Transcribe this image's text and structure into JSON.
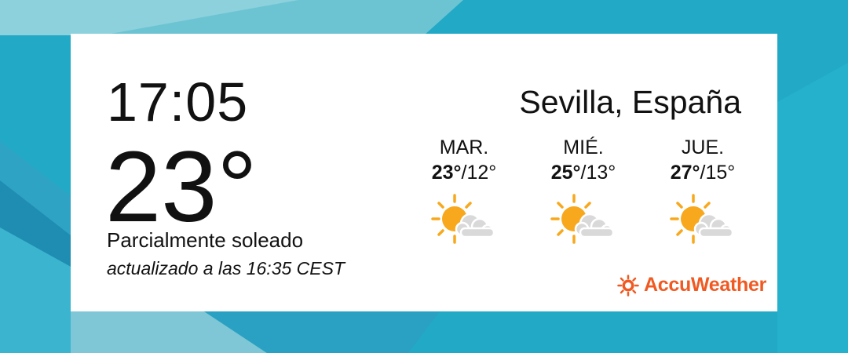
{
  "widget": {
    "time": "17:05",
    "temperature": "23°",
    "condition": "Parcialmente soleado",
    "updated": "actualizado a las 16:35 CEST",
    "location": "Sevilla, España",
    "forecast": [
      {
        "day": "MAR.",
        "high": "23°",
        "low": "/12°",
        "icon": "partly-sunny-icon"
      },
      {
        "day": "MIÉ.",
        "high": "25°",
        "low": "/13°",
        "icon": "partly-sunny-icon"
      },
      {
        "day": "JUE.",
        "high": "27°",
        "low": "/15°",
        "icon": "partly-sunny-icon"
      }
    ],
    "provider": "AccuWeather"
  },
  "colors": {
    "background": "#22a9c6",
    "card": "#ffffff",
    "text": "#111111",
    "brand": "#f05a22",
    "sun": "#f8a81c",
    "cloud": "#d9d9d9"
  }
}
